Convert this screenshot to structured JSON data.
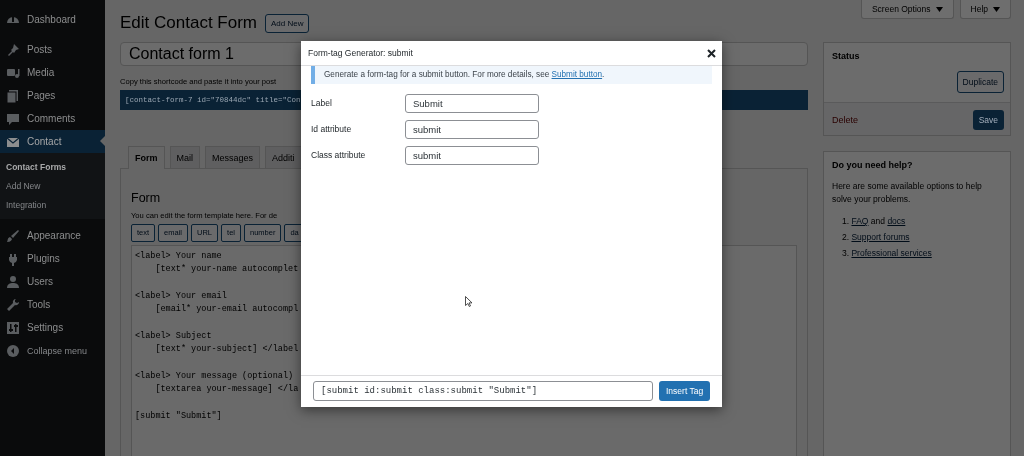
{
  "sidebar": {
    "menu": [
      {
        "label": "Dashboard",
        "selected": false
      },
      {
        "label": "Posts",
        "selected": false
      },
      {
        "label": "Media",
        "selected": false
      },
      {
        "label": "Pages",
        "selected": false
      },
      {
        "label": "Comments",
        "selected": false
      },
      {
        "label": "Contact",
        "selected": true,
        "children": [
          {
            "label": "Contact Forms",
            "selected": true
          },
          {
            "label": "Add New",
            "selected": false
          },
          {
            "label": "Integration",
            "selected": false
          }
        ]
      },
      {
        "label": "Appearance",
        "selected": false
      },
      {
        "label": "Plugins",
        "selected": false
      },
      {
        "label": "Users",
        "selected": false
      },
      {
        "label": "Tools",
        "selected": false
      },
      {
        "label": "Settings",
        "selected": false
      }
    ],
    "collapse": "Collapse menu"
  },
  "screen_meta": [
    "Screen Options",
    "Help"
  ],
  "page": {
    "title": "Edit Contact Form",
    "add_new": "Add New",
    "form_title": "Contact form 1",
    "shortcode_hint": "Copy this shortcode and paste it into your post",
    "shortcode": "[contact-form-7 id=\"70844dc\" title=\"Con",
    "tabs": [
      {
        "label": "Form",
        "selected": true
      },
      {
        "label": "Mail",
        "selected": false
      },
      {
        "label": "Messages",
        "selected": false
      },
      {
        "label": "Additi",
        "selected": false
      }
    ],
    "panel_heading": "Form",
    "panel_description": "You can edit the form template here. For de",
    "tag_buttons": [
      "text",
      "email",
      "URL",
      "tel",
      "number",
      "da"
    ],
    "template_blocks": [
      {
        "lines": [
          "<label> Your name",
          "    [text* your-name autocomplet"
        ]
      },
      {
        "lines": [
          "<label> Your email",
          "    [email* your-email autocompl"
        ]
      },
      {
        "lines": [
          "<label> Subject",
          "    [text* your-subject] </label"
        ]
      },
      {
        "lines": [
          "<label> Your message (optional)",
          "    [textarea your-message] </la"
        ]
      },
      {
        "lines": [
          "[submit \"Submit\"]"
        ]
      }
    ]
  },
  "status_box": {
    "title": "Status",
    "duplicate": "Duplicate",
    "delete": "Delete",
    "save": "Save"
  },
  "help_box": {
    "title": "Do you need help?",
    "text": "Here are some available options to help solve your problems.",
    "items": [
      {
        "number": "1.",
        "parts": [
          {
            "text": "FAQ",
            "link": true
          },
          {
            "text": " and ",
            "link": false
          },
          {
            "text": "docs",
            "link": true
          }
        ]
      },
      {
        "number": "2.",
        "parts": [
          {
            "text": "Support forums",
            "link": true
          }
        ]
      },
      {
        "number": "3.",
        "parts": [
          {
            "text": "Professional services",
            "link": true
          }
        ]
      }
    ]
  },
  "dialog": {
    "title": "Form-tag Generator: submit",
    "notice": {
      "text": "Generate a form-tag for a submit button. For more details, see ",
      "link": "Submit button",
      "after": "."
    },
    "fields": [
      {
        "label": "Label",
        "value": "Submit"
      },
      {
        "label": "Id attribute",
        "value": "submit"
      },
      {
        "label": "Class attribute",
        "value": "submit"
      }
    ],
    "tag_output": "[submit id:submit class:submit \"Submit\"]",
    "insert": "Insert Tag"
  }
}
